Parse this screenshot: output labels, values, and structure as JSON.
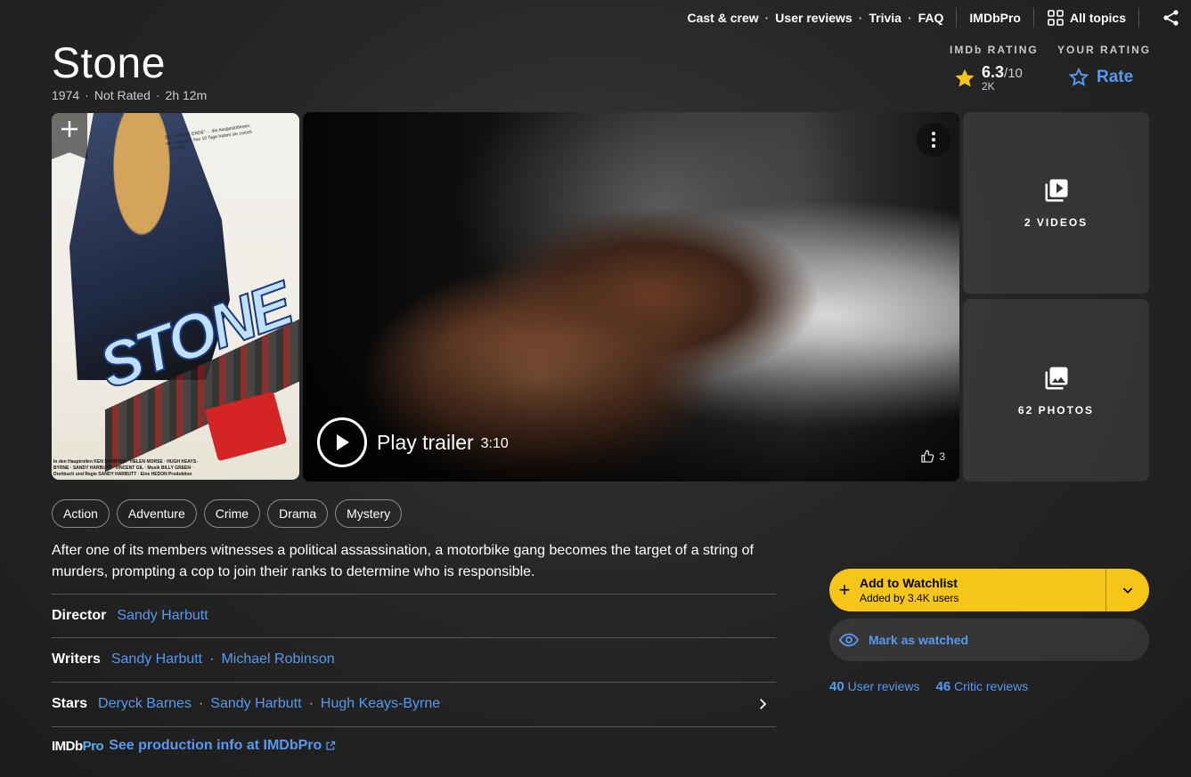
{
  "nav": {
    "cast_crew": "Cast & crew",
    "user_reviews": "User reviews",
    "trivia": "Trivia",
    "faq": "FAQ",
    "imdbpro": "IMDbPro",
    "all_topics": "All topics",
    "sep": "·"
  },
  "title": {
    "name": "Stone",
    "year": "1974",
    "rating_cert": "Not Rated",
    "runtime": "2h 12m",
    "dot": "·"
  },
  "imdb_rating": {
    "label": "IMDb RATING",
    "score": "6.3",
    "out_of": "/10",
    "votes": "2K"
  },
  "your_rating": {
    "label": "YOUR RATING",
    "action": "Rate"
  },
  "poster": {
    "logo_text": "STONE",
    "promo_text": "Die \"GRÜNE ERDE\" ... die Ausgestoßenen, die Gejagten. Nur 10 Tage haben sie zurück ... STONE",
    "credits_text": "In den Hauptrollen KEN SHORTER · HELEN MORSE · HUGH KEAYS-BYRNE · SANDY HARBUTT · VINCENT GIL · Musik BILLY GREEN · Drehbuch und Regie SANDY HARBUTT · Eine HEDON Produktion"
  },
  "video": {
    "play_label": "Play trailer",
    "duration": "3:10",
    "likes": "3"
  },
  "tiles": {
    "videos": "2 VIDEOS",
    "photos": "62 PHOTOS"
  },
  "genres": [
    "Action",
    "Adventure",
    "Crime",
    "Drama",
    "Mystery"
  ],
  "plot": "After one of its members witnesses a political assassination, a motorbike gang becomes the target of a string of murders, prompting a cop to join their ranks to determine who is responsible.",
  "credits": {
    "director": {
      "label": "Director",
      "names": [
        "Sandy Harbutt"
      ]
    },
    "writers": {
      "label": "Writers",
      "names": [
        "Sandy Harbutt",
        "Michael Robinson"
      ]
    },
    "stars": {
      "label": "Stars",
      "names": [
        "Deryck Barnes",
        "Sandy Harbutt",
        "Hugh Keays-Byrne"
      ]
    }
  },
  "imdbpro": {
    "brand_a": "IMDb",
    "brand_b": "Pro",
    "link": "See production info at IMDbPro"
  },
  "watchlist": {
    "label": "Add to Watchlist",
    "sub": "Added by 3.4K users",
    "plus": "+"
  },
  "watched": {
    "label": "Mark as watched"
  },
  "reviews": {
    "user_count": "40",
    "user_label": "User reviews",
    "critic_count": "46",
    "critic_label": "Critic reviews"
  },
  "colors": {
    "accent_blue": "#5799ef",
    "imdb_yellow": "#f5c518",
    "background": "#262626"
  }
}
